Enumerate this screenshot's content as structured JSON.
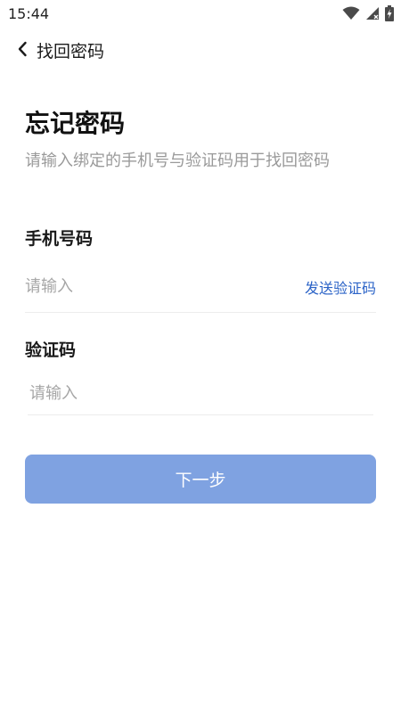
{
  "status_bar": {
    "time": "15:44"
  },
  "nav": {
    "title": "找回密码"
  },
  "header": {
    "title": "忘记密码",
    "subtitle": "请输入绑定的手机号与验证码用于找回密码"
  },
  "form": {
    "phone": {
      "label": "手机号码",
      "placeholder": "请输入",
      "value": ""
    },
    "send_code_label": "发送验证码",
    "code": {
      "label": "验证码",
      "placeholder": "请输入",
      "value": ""
    }
  },
  "next_button_label": "下一步",
  "colors": {
    "accent": "#2b63c7",
    "button": "#7fa2e1",
    "subtitle": "#9a9a9a"
  }
}
